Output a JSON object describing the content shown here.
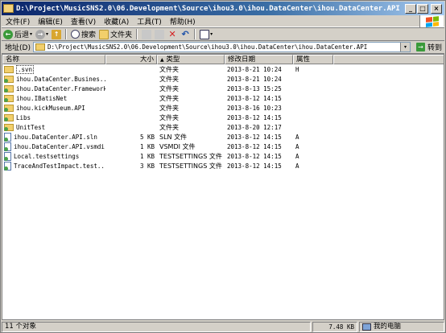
{
  "window": {
    "title": "D:\\Project\\MusicSNS2.0\\06.Development\\Source\\ihou3.0\\ihou.DataCenter\\ihou.DataCenter.API",
    "buttons": {
      "minimize": "_",
      "maximize": "□",
      "close": "×"
    }
  },
  "menu": {
    "items": [
      "文件(F)",
      "编辑(E)",
      "查看(V)",
      "收藏(A)",
      "工具(T)",
      "帮助(H)"
    ]
  },
  "toolbar": {
    "back_label": "后退",
    "search_label": "搜索",
    "folders_label": "文件夹",
    "back_icon": "←",
    "forward_icon": "→",
    "up_icon": "↑",
    "delete_icon": "✕",
    "undo_icon": "↶",
    "dropdown_glyph": "▾"
  },
  "address": {
    "label": "地址(D)",
    "path": "D:\\Project\\MusicSNS2.0\\06.Development\\Source\\ihou3.0\\ihou.DataCenter\\ihou.DataCenter.API",
    "go_label": "转到",
    "go_icon": "→",
    "dropdown_glyph": "▾"
  },
  "list": {
    "headers": {
      "name": "名称",
      "size": "大小",
      "type": "类型",
      "date": "修改日期",
      "attr": "属性",
      "sort_glyph": "▲"
    },
    "rows": [
      {
        "name": ".svn",
        "size": "",
        "type": "文件夹",
        "date": "2013-8-21 10:24",
        "attr": "H"
      },
      {
        "name": "ihou.DataCenter.Busines...",
        "size": "",
        "type": "文件夹",
        "date": "2013-8-21 10:24",
        "attr": ""
      },
      {
        "name": "ihou.DataCenter.Framework",
        "size": "",
        "type": "文件夹",
        "date": "2013-8-13 15:25",
        "attr": ""
      },
      {
        "name": "ihou.IBatisNet",
        "size": "",
        "type": "文件夹",
        "date": "2013-8-12 14:15",
        "attr": ""
      },
      {
        "name": "ihou.kickMuseum.API",
        "size": "",
        "type": "文件夹",
        "date": "2013-8-16 10:23",
        "attr": ""
      },
      {
        "name": "Libs",
        "size": "",
        "type": "文件夹",
        "date": "2013-8-12 14:15",
        "attr": ""
      },
      {
        "name": "UnitTest",
        "size": "",
        "type": "文件夹",
        "date": "2013-8-20 12:17",
        "attr": ""
      },
      {
        "name": "ihou.DataCenter.API.sln",
        "size": "5 KB",
        "type": "SLN 文件",
        "date": "2013-8-12 14:15",
        "attr": "A"
      },
      {
        "name": "ihou.DataCenter.API.vsmdi",
        "size": "1 KB",
        "type": "VSMDI 文件",
        "date": "2013-8-12 14:15",
        "attr": "A"
      },
      {
        "name": "Local.testsettings",
        "size": "1 KB",
        "type": "TESTSETTINGS 文件",
        "date": "2013-8-12 14:15",
        "attr": "A"
      },
      {
        "name": "TraceAndTestImpact.test...",
        "size": "3 KB",
        "type": "TESTSETTINGS 文件",
        "date": "2013-8-12 14:15",
        "attr": "A"
      }
    ]
  },
  "status": {
    "count": "11 个对象",
    "size": "7.48 KB",
    "location": "我的电脑"
  },
  "colors": {
    "accent": "#0a246a",
    "folder": "#f2cf6b",
    "chrome": "#d4d0c8"
  }
}
